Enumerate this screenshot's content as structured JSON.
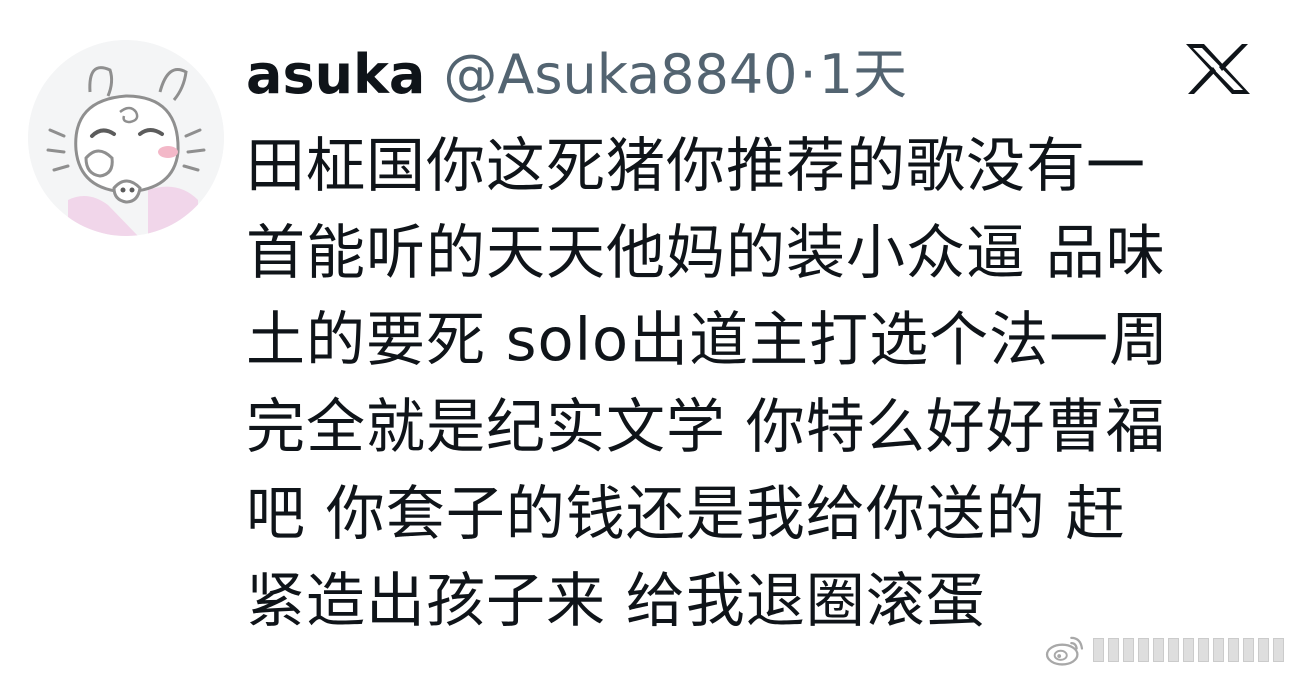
{
  "tweet": {
    "author": {
      "display_name": "asuka",
      "handle": "@Asuka8840",
      "avatar_icon": "cartoon-character-avatar-icon"
    },
    "separator": "·",
    "timestamp": "1天",
    "platform_icon": "x-logo-icon",
    "text": "田柾国你这死猪你推荐的歌没有一\n首能听的天天他妈的装小众逼 品味\n土的要死 solo出道主打选个法一周\n完全就是纪实文学 你特么好好曹福\n吧 你套子的钱还是我给你送的 赶\n紧造出孩子来 给我退圈滚蛋"
  },
  "watermark": {
    "icon": "weibo-logo-icon",
    "redacted": true
  },
  "colors": {
    "text_primary": "#0f1419",
    "text_secondary": "#536471",
    "background": "#ffffff"
  }
}
